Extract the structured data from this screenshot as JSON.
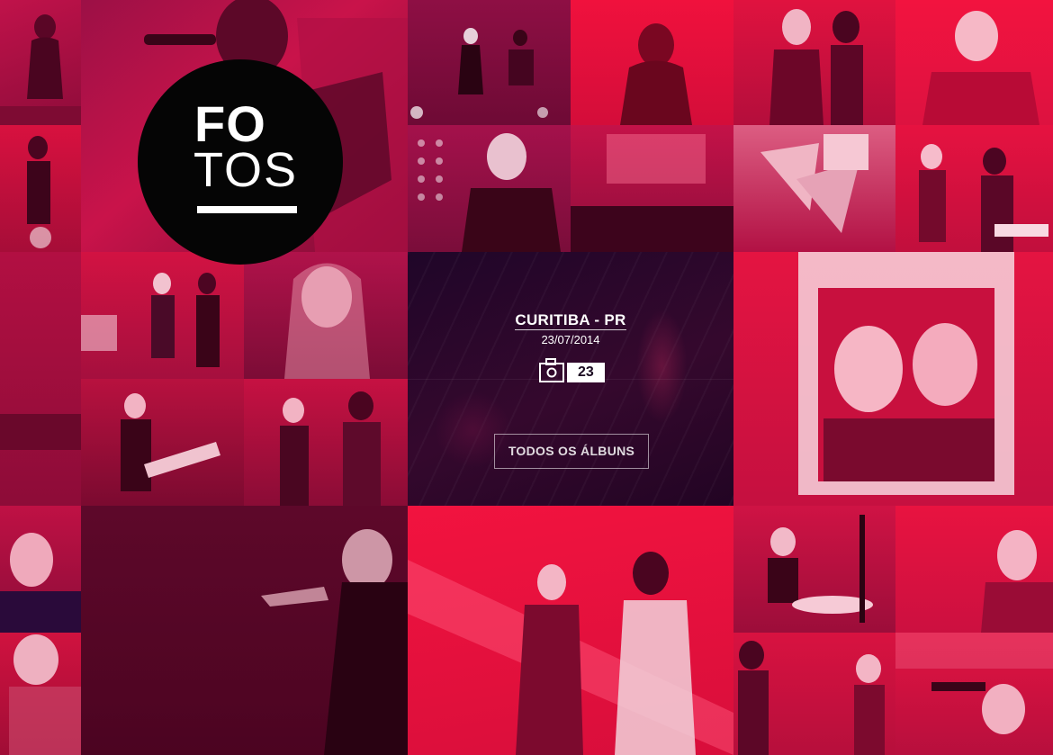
{
  "logo": {
    "line1": "FO",
    "line2": "TOS"
  },
  "featured_album": {
    "city": "CURITIBA - PR",
    "date": "23/07/2014",
    "photo_count": "23",
    "count_icon": "camera-icon"
  },
  "all_albums_button": "TODOS OS ÁLBUNS",
  "tile_colors": {
    "red": "#e8103f",
    "crimson": "#c70b3a",
    "magenta": "#a3134a",
    "wine": "#7a0d35",
    "dark": "#5c0a2c"
  }
}
